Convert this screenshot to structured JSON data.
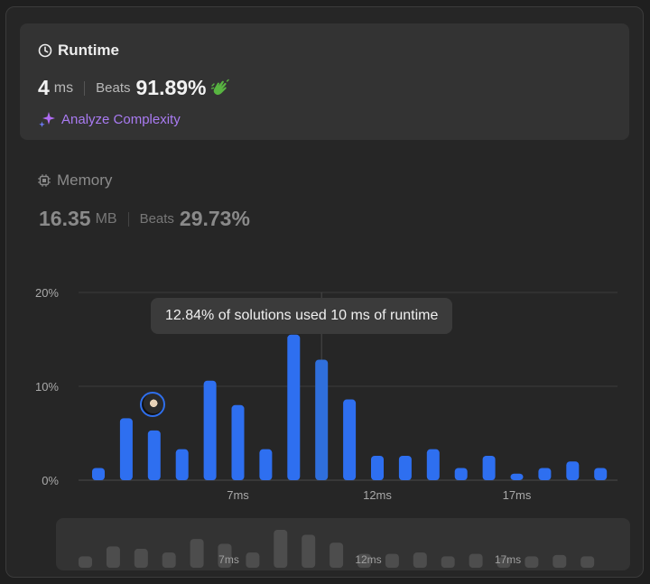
{
  "runtime": {
    "title": "Runtime",
    "value": "4",
    "unit": "ms",
    "beats_label": "Beats",
    "beats_value": "91.89%",
    "analyze_label": "Analyze Complexity"
  },
  "memory": {
    "title": "Memory",
    "value": "16.35",
    "unit": "MB",
    "beats_label": "Beats",
    "beats_value": "29.73%"
  },
  "tooltip": "12.84% of solutions used 10 ms of runtime",
  "colors": {
    "accent": "#2e6ff0",
    "selected": "#2f6fdc",
    "hand": "#58b441",
    "sparkle": "#a97bf2"
  },
  "chart_data": {
    "type": "bar",
    "y_ticks": [
      "20%",
      "10%",
      "0%"
    ],
    "ylim": [
      0,
      20
    ],
    "x_tick_labels": [
      {
        "index": 5,
        "label": "7ms"
      },
      {
        "index": 10,
        "label": "12ms"
      },
      {
        "index": 15,
        "label": "17ms"
      }
    ],
    "categories": [
      "2ms",
      "3ms",
      "4ms",
      "5ms",
      "6ms",
      "7ms",
      "8ms",
      "9ms",
      "10ms",
      "11ms",
      "12ms",
      "13ms",
      "14ms",
      "15ms",
      "16ms",
      "17ms",
      "18ms",
      "19ms",
      "20ms",
      "21ms"
    ],
    "values": [
      1.3,
      6.6,
      5.3,
      3.3,
      10.6,
      8.0,
      3.3,
      15.5,
      12.84,
      8.6,
      2.6,
      2.6,
      3.3,
      1.3,
      2.6,
      0.7,
      1.3,
      2.0,
      1.3,
      0
    ],
    "selected_category": "10ms",
    "user_category": "4ms",
    "overview": {
      "x_tick_labels": [
        {
          "index": 5,
          "label": "7ms"
        },
        {
          "index": 10,
          "label": "12ms"
        },
        {
          "index": 15,
          "label": "17ms"
        }
      ]
    }
  }
}
